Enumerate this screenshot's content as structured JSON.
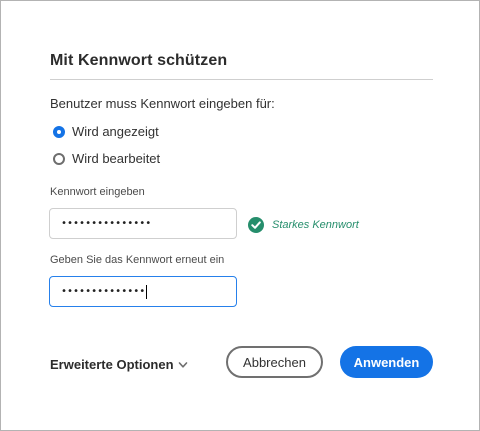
{
  "dialog": {
    "title": "Mit Kennwort schützen",
    "prompt": "Benutzer muss Kennwort eingeben für:",
    "options": [
      {
        "label": "Wird angezeigt",
        "checked": true
      },
      {
        "label": "Wird bearbeitet",
        "checked": false
      }
    ],
    "password": {
      "label": "Kennwort eingeben",
      "value": "•••••••••••••••",
      "strength_text": "Starkes Kennwort"
    },
    "confirm": {
      "label": "Geben Sie das Kennwort erneut ein",
      "value": "••••••••••••••"
    },
    "advanced_label": "Erweiterte Optionen",
    "cancel_label": "Abbrechen",
    "apply_label": "Anwenden"
  },
  "colors": {
    "accent": "#1473e6",
    "success": "#268e6c",
    "focus_border": "#2680eb"
  },
  "icons": {
    "strength": "check-circle-icon",
    "advanced": "chevron-down-icon"
  }
}
